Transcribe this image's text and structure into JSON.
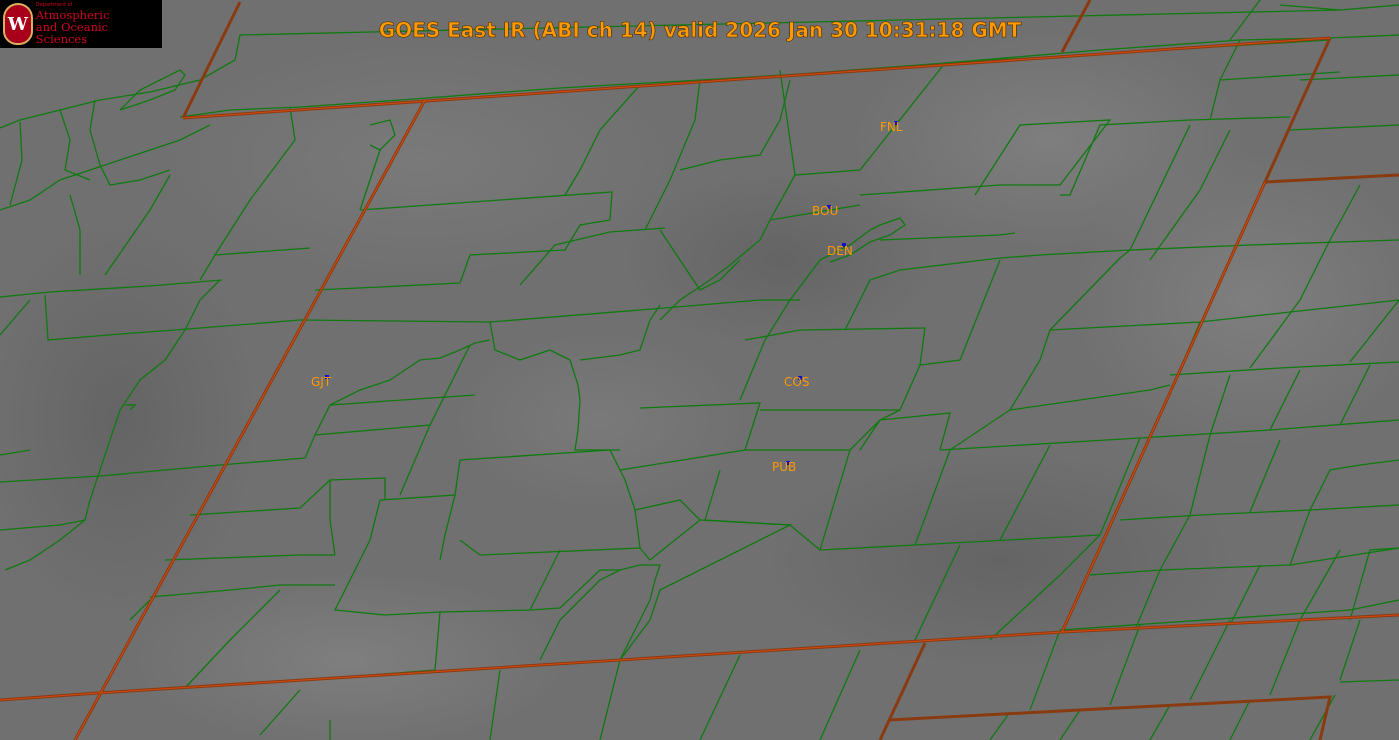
{
  "title": "GOES East IR (ABI ch 14) valid 2026 Jan 30 10:31:18 GMT",
  "logo": {
    "department": "Department of",
    "line1": "Atmospheric",
    "line2": "and Oceanic Sciences"
  },
  "stations": [
    {
      "id": "FNL",
      "label": "FNL"
    },
    {
      "id": "BOU",
      "label": "BOU"
    },
    {
      "id": "DEN",
      "label": "DEN"
    },
    {
      "id": "GJT",
      "label": "GJT"
    },
    {
      "id": "COS",
      "label": "COS"
    },
    {
      "id": "PUB",
      "label": "PUB"
    }
  ],
  "colors": {
    "title": "#ff9900",
    "station_label": "#ff9900",
    "station_marker": "#1010cc",
    "county_lines": "#0f7a10",
    "state_lines": "#8a3a10",
    "background": "#6f6f6f"
  }
}
